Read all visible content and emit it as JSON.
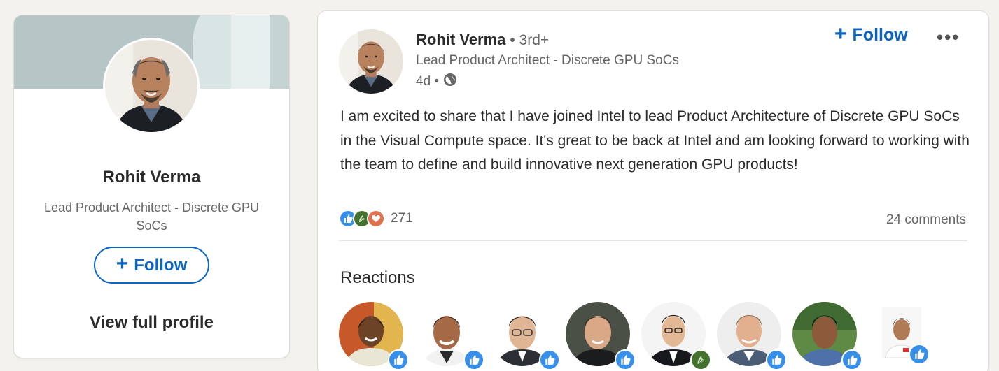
{
  "colors": {
    "accent": "#0a66c2",
    "like": "#378fe9",
    "celebrate": "#44712e",
    "love": "#df704d",
    "banner": "#b6c6c7"
  },
  "profile_card": {
    "name": "Rohit Verma",
    "headline": "Lead Product Architect - Discrete GPU SoCs",
    "follow_label": "Follow",
    "view_profile_label": "View full profile"
  },
  "post": {
    "author_name": "Rohit Verma",
    "degree": "• 3rd+",
    "author_headline": "Lead Product Architect - Discrete GPU SoCs",
    "time": "4d •",
    "visibility_icon": "globe-icon",
    "follow_label": "Follow",
    "more_label": "•••",
    "body": "I am excited to share that I have joined Intel to lead Product Architecture of Discrete GPU SoCs in the Visual Compute space. It's great to be back at Intel and am looking forward to working with the team to define and build innovative next generation GPU products!",
    "reaction_icons": [
      "like-icon",
      "celebrate-icon",
      "love-icon"
    ],
    "reaction_count": "271",
    "comments": "24 comments"
  },
  "reactions": {
    "title": "Reactions",
    "people": [
      {
        "reaction": "like-icon"
      },
      {
        "reaction": "like-icon"
      },
      {
        "reaction": "like-icon"
      },
      {
        "reaction": "like-icon"
      },
      {
        "reaction": "celebrate-icon"
      },
      {
        "reaction": "like-icon"
      },
      {
        "reaction": "like-icon"
      },
      {
        "reaction": "like-icon"
      }
    ]
  }
}
